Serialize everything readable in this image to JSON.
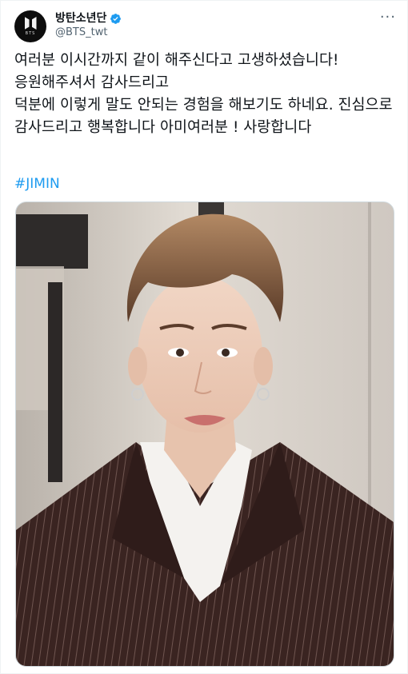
{
  "account": {
    "display_name": "방탄소년단",
    "handle": "@BTS_twt",
    "avatar_logo_text": "BTS",
    "verified": true,
    "verified_color": "#1d9bf0"
  },
  "tweet": {
    "lines": [
      "여러분 이시간까지 같이 해주신다고 고생하셨습니다!",
      "응원해주셔서 감사드리고",
      "덕분에 이렇게 말도 안되는 경험을 해보기도 하네요. 진심으로 감사드리고 행복합니다 아미여러분 ! 사랑합니다"
    ],
    "hashtag": "#JIMIN",
    "hashtag_color": "#1d9bf0"
  },
  "icons": {
    "more": "more-options-icon",
    "verified": "verified-badge-icon"
  },
  "media": {
    "description": "selfie photo",
    "type": "image"
  }
}
